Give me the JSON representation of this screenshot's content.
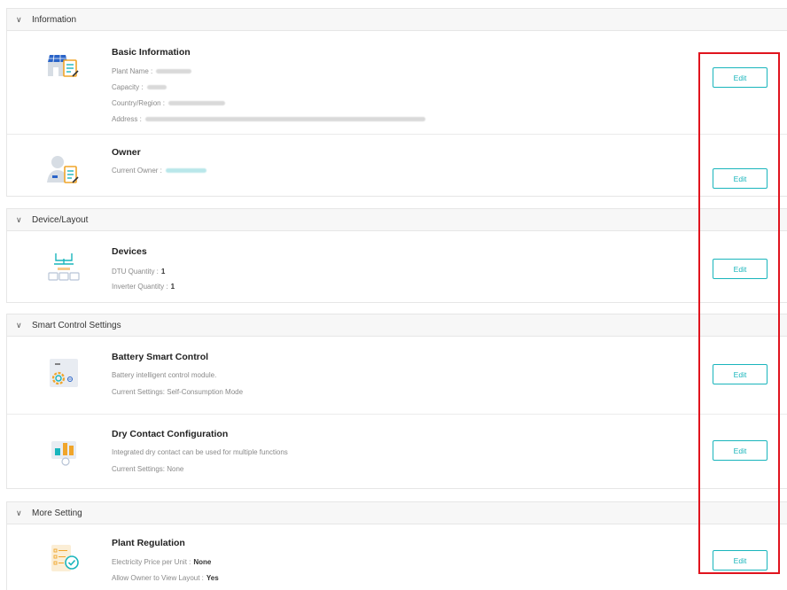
{
  "sections": {
    "information": {
      "header": "Information",
      "basic": {
        "title": "Basic Information",
        "plant_name_label": "Plant Name :",
        "capacity_label": "Capacity :",
        "country_label": "Country/Region :",
        "address_label": "Address :",
        "edit_label": "Edit"
      },
      "owner": {
        "title": "Owner",
        "current_owner_label": "Current Owner :",
        "edit_label": "Edit"
      }
    },
    "device_layout": {
      "header": "Device/Layout",
      "devices": {
        "title": "Devices",
        "dtu_label": "DTU Quantity :",
        "dtu_value": "1",
        "inverter_label": "Inverter Quantity :",
        "inverter_value": "1",
        "edit_label": "Edit"
      }
    },
    "smart_control": {
      "header": "Smart Control Settings",
      "battery": {
        "title": "Battery Smart Control",
        "desc": "Battery intelligent control module.",
        "current": "Current Settings: Self-Consumption Mode",
        "edit_label": "Edit"
      },
      "dry_contact": {
        "title": "Dry Contact Configuration",
        "desc": "Integrated dry contact can be used for multiple functions",
        "current": "Current Settings: None",
        "edit_label": "Edit"
      }
    },
    "more_setting": {
      "header": "More Setting",
      "plant_regulation": {
        "title": "Plant Regulation",
        "price_label": "Electricity Price per Unit :",
        "price_value": "None",
        "allow_label": "Allow Owner to View Layout :",
        "allow_value": "Yes",
        "edit_label": "Edit"
      }
    }
  },
  "icons": {
    "chevron": "chevron-down",
    "accent": "#19b5bc",
    "highlight": "#e0141e"
  }
}
